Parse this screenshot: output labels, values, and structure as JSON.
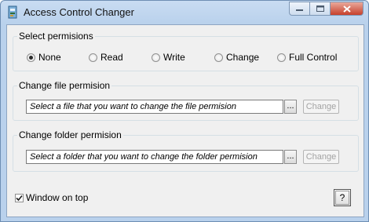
{
  "window": {
    "title": "Access Control Changer"
  },
  "caption_buttons": {
    "minimize": "—",
    "maximize": "☐",
    "close": "✕"
  },
  "permissions": {
    "legend": "Select permisions",
    "options": [
      "None",
      "Read",
      "Write",
      "Change",
      "Full Control"
    ],
    "selected": "None"
  },
  "file_permission": {
    "legend": "Change file permision",
    "path_value": "Select a file that you want to change the file permision",
    "browse_label": "...",
    "change_label": "Change"
  },
  "folder_permission": {
    "legend": "Change folder permision",
    "path_value": "Select a folder that you want to change the folder permision",
    "browse_label": "...",
    "change_label": "Change"
  },
  "window_on_top": {
    "label": "Window on top",
    "checked": true
  },
  "help_label": "?"
}
